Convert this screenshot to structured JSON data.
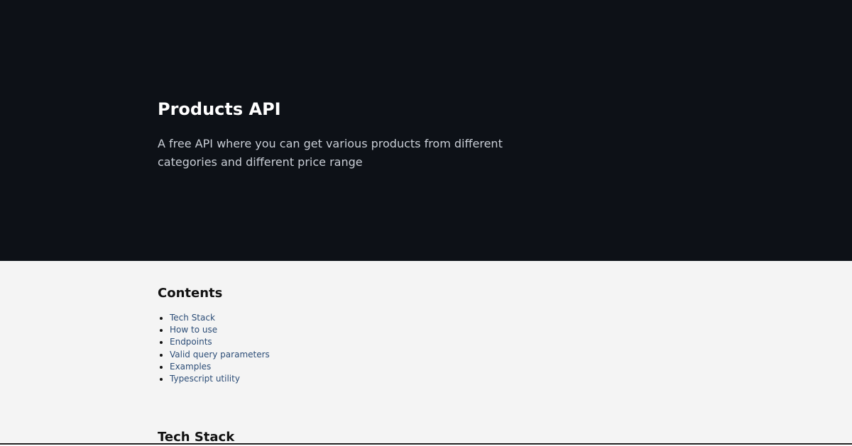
{
  "hero": {
    "title": "Products API",
    "description": "A free API where you can get various products from different categories and different price range"
  },
  "contents": {
    "title": "Contents",
    "items": [
      {
        "label": "Tech Stack"
      },
      {
        "label": "How to use"
      },
      {
        "label": "Endpoints"
      },
      {
        "label": "Valid query parameters"
      },
      {
        "label": "Examples"
      },
      {
        "label": "Typescript utility"
      }
    ]
  },
  "sections": {
    "tech_stack_title": "Tech Stack"
  },
  "colors": {
    "hero_background": "#0d1117",
    "page_background": "#f4f4f4",
    "link": "#2c4d77"
  }
}
